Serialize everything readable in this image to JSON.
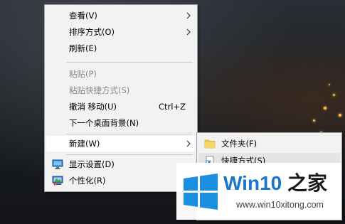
{
  "context_menu": {
    "items": [
      {
        "label": "查看(V)",
        "submenu": true,
        "disabled": false
      },
      {
        "label": "排序方式(O)",
        "submenu": true,
        "disabled": false
      },
      {
        "label": "刷新(E)",
        "submenu": false,
        "disabled": false
      },
      {
        "label": "粘贴(P)",
        "submenu": false,
        "disabled": true
      },
      {
        "label": "粘贴快捷方式(S)",
        "submenu": false,
        "disabled": true
      },
      {
        "label": "撤消 移动(U)",
        "shortcut": "Ctrl+Z",
        "submenu": false,
        "disabled": false
      },
      {
        "label": "下一个桌面背景(N)",
        "submenu": false,
        "disabled": false
      },
      {
        "label": "新建(W)",
        "submenu": true,
        "disabled": false,
        "highlighted": true
      },
      {
        "label": "显示设置(D)",
        "icon": "display-settings-icon",
        "submenu": false,
        "disabled": false
      },
      {
        "label": "个性化(R)",
        "icon": "personalize-icon",
        "submenu": false,
        "disabled": false
      }
    ]
  },
  "new_submenu": {
    "items": [
      {
        "label": "文件夹(F)",
        "icon": "folder-icon"
      },
      {
        "label": "快捷方式(S)",
        "icon": "shortcut-icon",
        "highlighted": true
      }
    ]
  },
  "watermark": {
    "brand": "Win10",
    "suffix": " 之家",
    "url": "www.win10xitong.com"
  },
  "colors": {
    "menu_bg": "#f2f2f2",
    "highlight": "#ffffff",
    "disabled_text": "#8a8a8a",
    "brand_blue": "#1a76c8",
    "folder_yellow": "#f6c94a"
  }
}
